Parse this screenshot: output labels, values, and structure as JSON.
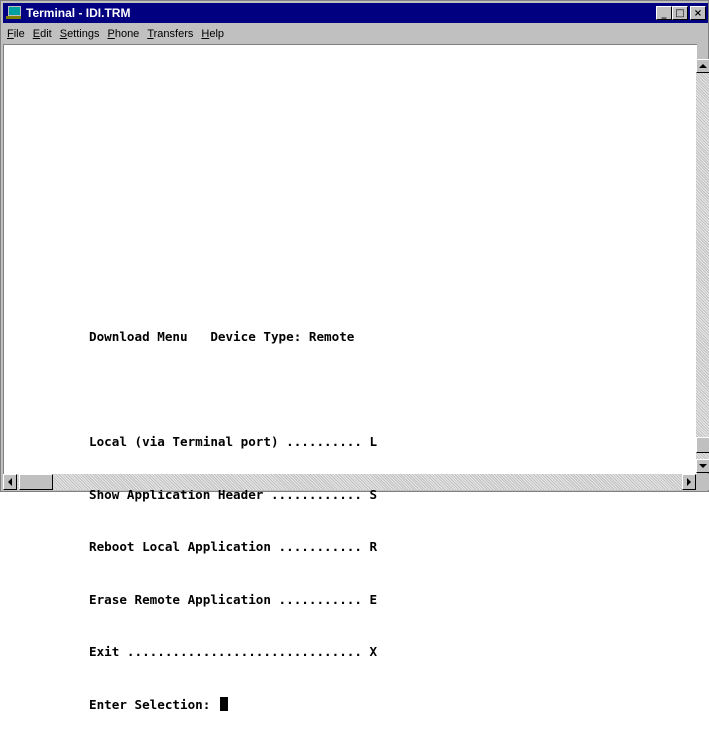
{
  "window": {
    "title": "Terminal - IDI.TRM",
    "controls": {
      "minimize": "_",
      "maximize": "□",
      "close": "×"
    }
  },
  "menubar": {
    "items": [
      {
        "u": "F",
        "rest": "ile"
      },
      {
        "u": "E",
        "rest": "dit"
      },
      {
        "u": "S",
        "rest": "ettings"
      },
      {
        "u": "P",
        "rest": "hone"
      },
      {
        "u": "T",
        "rest": "ransfers"
      },
      {
        "u": "H",
        "rest": "elp"
      }
    ]
  },
  "terminal": {
    "header": "Download Menu   Device Type: Remote",
    "options": [
      "Local (via Terminal port) .......... L",
      "Show Application Header ............ S",
      "Reboot Local Application ........... R",
      "Erase Remote Application ........... E",
      "Exit ............................... X"
    ],
    "prompt": "Enter Selection: "
  },
  "icons": {
    "app": "terminal-app-icon",
    "scroll_up": "arrow-up-icon",
    "scroll_down": "arrow-down-icon",
    "scroll_left": "arrow-left-icon",
    "scroll_right": "arrow-right-icon"
  },
  "colors": {
    "titlebar": "#000080",
    "chrome": "#c0c0c0",
    "screen": "#ffffff",
    "text": "#000000"
  }
}
